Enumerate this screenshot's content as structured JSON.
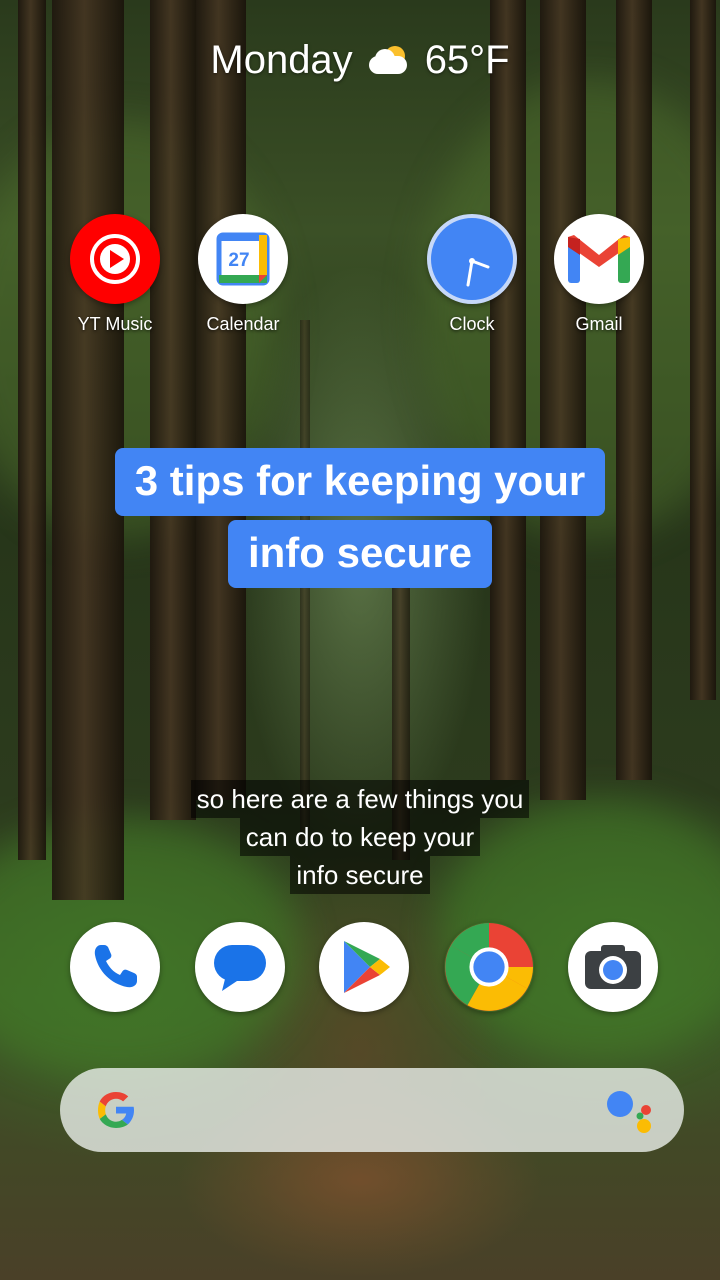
{
  "status": {
    "day": "Monday",
    "weather_icon": "partly-cloudy-icon",
    "temperature": "65°F"
  },
  "apps_top": [
    {
      "label": "YT Music",
      "icon": "yt-music-icon",
      "color": "#ff0000"
    },
    {
      "label": "Calendar",
      "icon": "calendar-icon",
      "day_number": "27",
      "color": "#4285f4"
    },
    {
      "label": "Clock",
      "icon": "clock-icon",
      "color": "#4285f4"
    },
    {
      "label": "Gmail",
      "icon": "gmail-icon",
      "color": "#ea4335"
    }
  ],
  "headline": {
    "line1": "3 tips for keeping your",
    "line2": "info secure",
    "background": "#4285f4"
  },
  "caption": {
    "line1": "so here are a few things you",
    "line2": "can do to keep your",
    "line3": "info secure"
  },
  "dock": [
    {
      "icon": "phone-icon"
    },
    {
      "icon": "messages-icon"
    },
    {
      "icon": "play-store-icon"
    },
    {
      "icon": "chrome-icon"
    },
    {
      "icon": "camera-icon"
    }
  ],
  "search": {
    "google_icon": "google-g-icon",
    "assistant_icon": "google-assistant-icon"
  }
}
